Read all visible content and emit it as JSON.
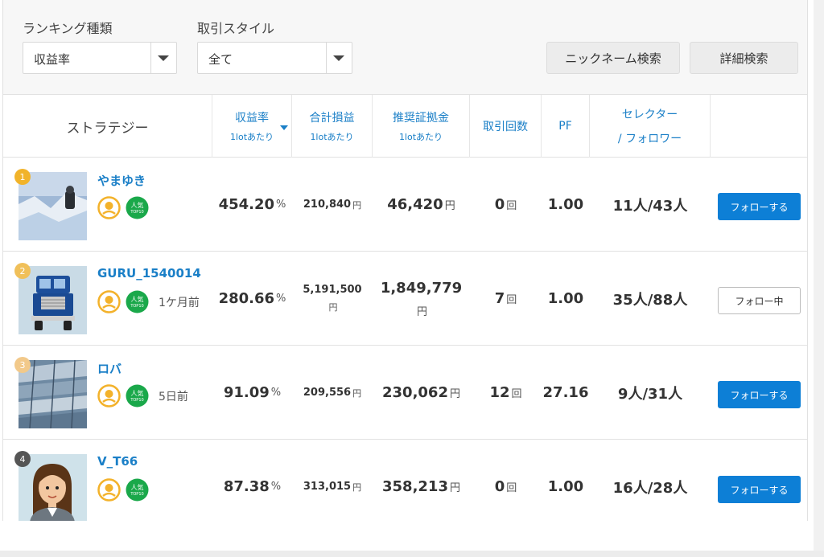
{
  "filters": {
    "ranking_type": {
      "label": "ランキング種類",
      "value": "収益率"
    },
    "trade_style": {
      "label": "取引スタイル",
      "value": "全て"
    },
    "nickname_search": "ニックネーム検索",
    "detail_search": "詳細検索"
  },
  "table": {
    "headers": {
      "strategy": "ストラテジー",
      "return_rate": {
        "line1": "収益率",
        "line2": "1lotあたり"
      },
      "total_pl": {
        "line1": "合計損益",
        "line2": "1lotあたり"
      },
      "margin": {
        "line1": "推奨証拠金",
        "line2": "1lotあたり"
      },
      "trades": "取引回数",
      "pf": "PF",
      "selectors": {
        "line1": "セレクター",
        "line2": "/ フォロワー"
      }
    },
    "rows": [
      {
        "rank": "1",
        "name": "やまゆき",
        "ago": "",
        "return_value": "454.20",
        "return_unit": "%",
        "pl_value": "210,840",
        "pl_unit": "円",
        "margin_value": "46,420",
        "margin_unit": "円",
        "trades_value": "0",
        "trades_unit": "回",
        "pf": "1.00",
        "selectors": "11人/43人",
        "follow_label": "フォローする",
        "following": false
      },
      {
        "rank": "2",
        "name": "GURU_1540014",
        "ago": "1ケ月前",
        "return_value": "280.66",
        "return_unit": "%",
        "pl_value": "5,191,500",
        "pl_unit": "円",
        "margin_value": "1,849,779",
        "margin_unit": "円",
        "trades_value": "7",
        "trades_unit": "回",
        "pf": "1.00",
        "selectors": "35人/88人",
        "follow_label": "フォロー中",
        "following": true
      },
      {
        "rank": "3",
        "name": "ロバ",
        "ago": "5日前",
        "return_value": "91.09",
        "return_unit": "%",
        "pl_value": "209,556",
        "pl_unit": "円",
        "margin_value": "230,062",
        "margin_unit": "円",
        "trades_value": "12",
        "trades_unit": "回",
        "pf": "27.16",
        "selectors": "9人/31人",
        "follow_label": "フォローする",
        "following": false
      },
      {
        "rank": "4",
        "name": "V_T66",
        "ago": "",
        "return_value": "87.38",
        "return_unit": "%",
        "pl_value": "313,015",
        "pl_unit": "円",
        "margin_value": "358,213",
        "margin_unit": "円",
        "trades_value": "0",
        "trades_unit": "回",
        "pf": "1.00",
        "selectors": "16人/28人",
        "follow_label": "フォローする",
        "following": false
      }
    ]
  },
  "badge": {
    "popular_line1": "人気",
    "popular_line2": "TOP10"
  },
  "colors": {
    "accent": "#1a7fc7",
    "follow_button": "#0d7fd6",
    "rank_gold": "#f1b32a",
    "rank_silver": "#f0c05a",
    "rank_bronze": "#f2c98a",
    "rank_other": "#555555",
    "popular_badge": "#1aa84a",
    "medal": "#f3b22b"
  },
  "icons": {
    "sort": "caret-down-icon",
    "select_arrow": "chevron-down-icon",
    "medal": "medal-icon",
    "popular": "popular-top10-badge"
  }
}
